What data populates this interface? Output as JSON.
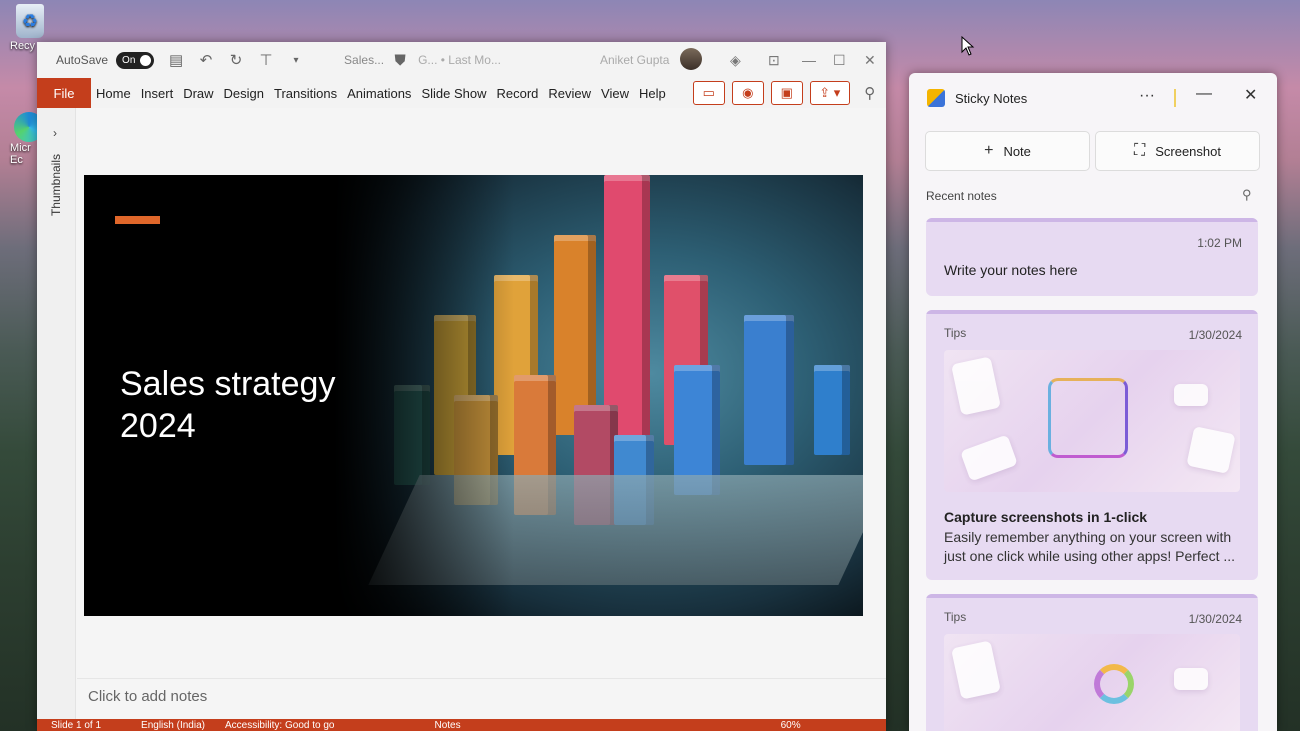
{
  "desktop": {
    "recycle_label": "Recy",
    "edge_label": "Micr Ec"
  },
  "ppt": {
    "autosave_label": "AutoSave",
    "autosave_state": "On",
    "doc_title": "Sales...",
    "title_meta": "G... • Last Mo...",
    "user_name": "Aniket Gupta",
    "tabs": [
      "File",
      "Home",
      "Insert",
      "Draw",
      "Design",
      "Transitions",
      "Animations",
      "Slide Show",
      "Record",
      "Review",
      "View",
      "Help"
    ],
    "slide_title_line1": "Sales strategy",
    "slide_title_line2": "2024",
    "notes_placeholder": "Click to add notes",
    "thumbnails_label": "Thumbnails",
    "status_slide": "Slide 1 of 1",
    "status_lang": "English (India)",
    "status_access": "Accessibility: Good to go",
    "status_notes": "Notes",
    "zoom": "60%"
  },
  "sticky": {
    "title": "Sticky Notes",
    "note_btn": "Note",
    "screenshot_btn": "Screenshot",
    "recent_label": "Recent notes",
    "card1": {
      "time": "1:02 PM",
      "body": "Write your notes here"
    },
    "card2": {
      "tag": "Tips",
      "date": "1/30/2024",
      "heading": "Capture screenshots in 1-click",
      "text": "Easily remember anything on your screen with just one click while using other apps! Perfect ..."
    },
    "card3": {
      "tag": "Tips",
      "date": "1/30/2024"
    }
  },
  "colors": {
    "ppt_accent": "#c43e1c",
    "sticky_card": "#e7daf2",
    "slide_accent": "#e0672a"
  }
}
